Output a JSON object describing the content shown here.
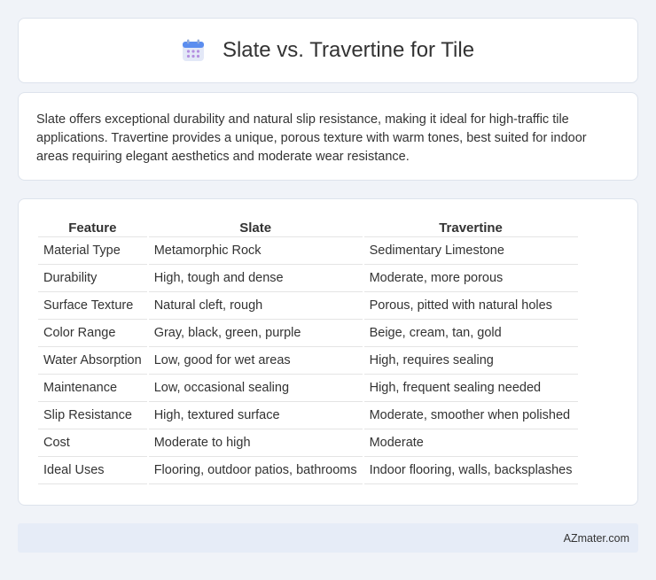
{
  "title": "Slate vs. Travertine for Tile",
  "summary": "Slate offers exceptional durability and natural slip resistance, making it ideal for high-traffic tile applications. Travertine provides a unique, porous texture with warm tones, best suited for indoor areas requiring elegant aesthetics and moderate wear resistance.",
  "table": {
    "headers": [
      "Feature",
      "Slate",
      "Travertine"
    ],
    "rows": [
      [
        "Material Type",
        "Metamorphic Rock",
        "Sedimentary Limestone"
      ],
      [
        "Durability",
        "High, tough and dense",
        "Moderate, more porous"
      ],
      [
        "Surface Texture",
        "Natural cleft, rough",
        "Porous, pitted with natural holes"
      ],
      [
        "Color Range",
        "Gray, black, green, purple",
        "Beige, cream, tan, gold"
      ],
      [
        "Water Absorption",
        "Low, good for wet areas",
        "High, requires sealing"
      ],
      [
        "Maintenance",
        "Low, occasional sealing",
        "High, frequent sealing needed"
      ],
      [
        "Slip Resistance",
        "High, textured surface",
        "Moderate, smoother when polished"
      ],
      [
        "Cost",
        "Moderate to high",
        "Moderate"
      ],
      [
        "Ideal Uses",
        "Flooring, outdoor patios, bathrooms",
        "Indoor flooring, walls, backsplashes"
      ]
    ]
  },
  "footer": "AZmater.com",
  "icon": "calendar-icon",
  "colors": {
    "background": "#f0f3f8",
    "footer_bg": "#e6ecf7",
    "icon_accent": "#5b8def"
  }
}
